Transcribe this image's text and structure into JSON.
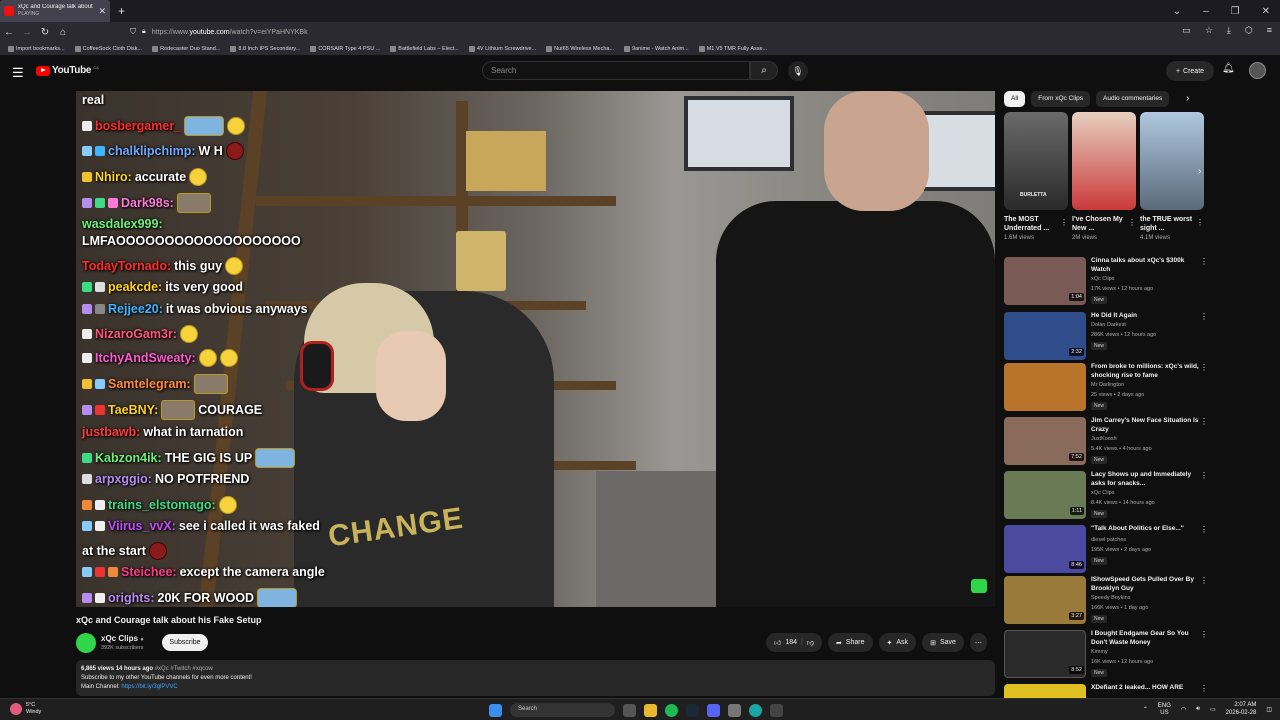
{
  "browser": {
    "tab_title": "xQc and Courage talk about hi",
    "tab_status": "PLAYING",
    "url_prefix": "https://www.",
    "url_domain": "youtube.com",
    "url_path": "/watch?v=eiYPaHNYKBk",
    "bookmarks": [
      "Import bookmarks...",
      "CoffeeSock Cloth Disk...",
      "Rodecaster Duo Stand...",
      "8.8 Inch IPS Secondary...",
      "CORSAIR Type 4 PSU ...",
      "Battlefield Labs – Elect...",
      "4V Lithium Screwdrive...",
      "Nut65 Wireless Mecha...",
      "9anime - Watch Anim...",
      "M1 V5 TMR Fully Asse..."
    ]
  },
  "youtube": {
    "logo_text": "YouTube",
    "logo_country": "CA",
    "search_placeholder": "Search",
    "create_label": "Create"
  },
  "video": {
    "title": "xQc and Courage talk about his Fake Setup",
    "channel": "xQc Clips",
    "subscribers": "392K subscribers",
    "subscribe_label": "Subscribe",
    "likes": "184",
    "share_label": "Share",
    "ask_label": "Ask",
    "save_label": "Save",
    "shirt_text": "CHANGE",
    "description": {
      "stats": "6,865 views  14 hours ago",
      "tags": "#xQc #Twitch #xqcow",
      "line1": "Subscribe to my other YouTube channels for even more content!",
      "line2_label": "Main Channel: ",
      "line2_link": "https://bit.ly/3glPVVC"
    },
    "chat": [
      {
        "user": "",
        "msg": "real",
        "color": "#ffffff"
      },
      {
        "user": "bosbergamer_",
        "msg": "",
        "color": "#ff2a2a"
      },
      {
        "user": "chalklipchimp:",
        "msg": "W H",
        "color": "#6fa8ff"
      },
      {
        "user": "Nhiro:",
        "msg": "accurate",
        "color": "#ffd21f"
      },
      {
        "user": "Dark98s:",
        "msg": "",
        "color": "#ff7ad9"
      },
      {
        "user": "wasdalex999:",
        "msg": "",
        "color": "#6cf078"
      },
      {
        "user": "",
        "msg": "LMFAOOOOOOOOOOOOOOOOOOO",
        "color": "#ffffff"
      },
      {
        "user": "TodayTornado:",
        "msg": "this guy",
        "color": "#ff2a2a"
      },
      {
        "user": "peakcde:",
        "msg": "its very good",
        "color": "#ffd21f"
      },
      {
        "user": "Rejjee20:",
        "msg": "it was obvious anyways",
        "color": "#3fb4ff"
      },
      {
        "user": "NizaroGam3r:",
        "msg": "",
        "color": "#ff5577"
      },
      {
        "user": "ItchyAndSweaty:",
        "msg": "",
        "color": "#ff5ad0"
      },
      {
        "user": "Samtelegram:",
        "msg": "",
        "color": "#ff8a3a"
      },
      {
        "user": "TaeBNY:",
        "msg": "COURAGE",
        "color": "#ffd21f"
      },
      {
        "user": "justbawb:",
        "msg": "what in tarnation",
        "color": "#ff3a3a"
      },
      {
        "user": "Kabzon4ik:",
        "msg": "THE GIG IS UP",
        "color": "#6cf078"
      },
      {
        "user": "arpxggio:",
        "msg": "NO POTFRIEND",
        "color": "#b58cf0"
      },
      {
        "user": "trains_elstomago:",
        "msg": "",
        "color": "#3ddc84"
      },
      {
        "user": "Viirus_vvX:",
        "msg": "see i called it was faked",
        "color": "#c04bff"
      },
      {
        "user": "",
        "msg": "at the start",
        "color": "#ffffff"
      },
      {
        "user": "Steichee:",
        "msg": "except the camera angle",
        "color": "#ff3a8a"
      },
      {
        "user": "orights:",
        "msg": "20K FOR WOOD",
        "color": "#b58cf0"
      }
    ]
  },
  "sidebar": {
    "chips": [
      "All",
      "From xQc Clips",
      "Audio commentaries"
    ],
    "shorts": [
      {
        "title": "The MOST Underrated ...",
        "views": "1.6M views",
        "color": "#5a5a5a"
      },
      {
        "title": "I've Chosen My New ...",
        "views": "2M views",
        "color": "#c93a3a"
      },
      {
        "title": "the TRUE worst sight ...",
        "views": "4.1M views",
        "color": "#8aa0b8"
      }
    ],
    "shorts_overlay": "BURLETTA",
    "recommended": [
      {
        "title": "Cinna talks about xQc's $300k Watch",
        "channel": "xQc Clips",
        "meta": "17K views • 12 hours ago",
        "duration": "1:04",
        "color": "#7a5a55"
      },
      {
        "title": "He Did It Again",
        "channel": "Dolan Darkest",
        "meta": "286K views • 12 hours ago",
        "duration": "2:32",
        "color": "#2f4d8a"
      },
      {
        "title": "From broke to millions: xQc's wild, shocking rise to fame",
        "channel": "Mr Darlington",
        "meta": "25 views • 2 days ago",
        "duration": "",
        "color": "#b8742a"
      },
      {
        "title": "Jim Carrey's New Face Situation Is Crazy",
        "channel": "JustKoosh",
        "meta": "5.4K views • 4 hours ago",
        "duration": "7:52",
        "color": "#8a6a5a"
      },
      {
        "title": "Lacy Shows up and Immediately asks for snacks...",
        "channel": "xQc Clips",
        "meta": "8.4K views • 14 hours ago",
        "duration": "1:11",
        "color": "#6a7a55"
      },
      {
        "title": "\"Talk About Politics or Else...\"",
        "channel": "diesel patches",
        "meta": "195K views • 2 days ago",
        "duration": "8:46",
        "color": "#4a4aa0"
      },
      {
        "title": "IShowSpeed Gets Pulled Over By Brooklyn Guy",
        "channel": "Speedy Boykins",
        "meta": "166K views • 1 day ago",
        "duration": "3:27",
        "color": "#9a7a3a"
      },
      {
        "title": "I Bought Endgame Gear So You Don't Waste Money",
        "channel": "Kimmy",
        "meta": "16K views • 12 hours ago",
        "duration": "8:52",
        "color": "#2a2a2a"
      },
      {
        "title": "XDefiant 2 leaked... HOW ARE",
        "channel": "",
        "meta": "",
        "duration": "",
        "color": "#e0c020"
      }
    ],
    "new_label": "New"
  },
  "taskbar": {
    "temp": "5°C",
    "weather": "Windy",
    "search": "Search",
    "lang1": "ENG",
    "lang2": "US",
    "time": "2:07 AM",
    "date": "2026-02-28"
  }
}
